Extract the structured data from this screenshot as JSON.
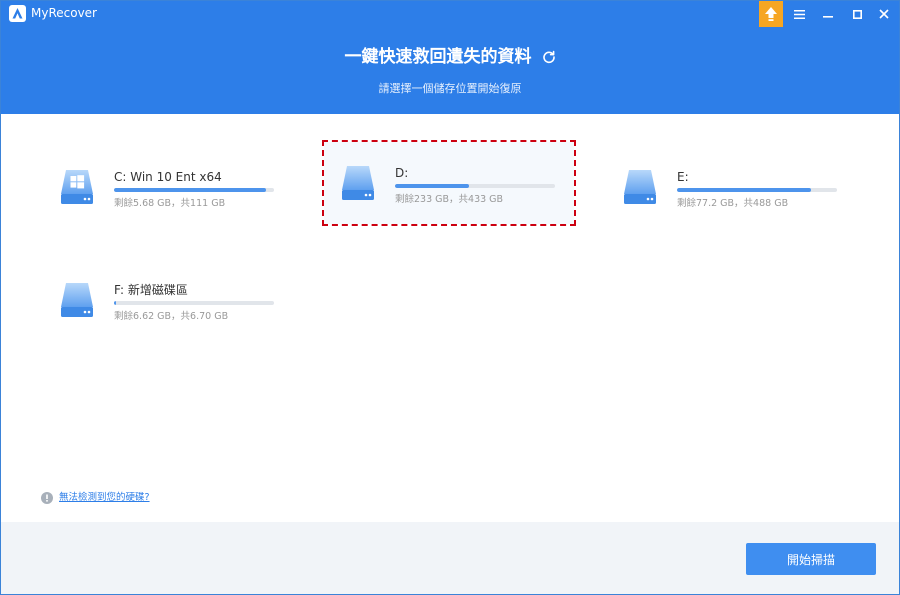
{
  "app": {
    "name": "MyRecover"
  },
  "header": {
    "title": "一鍵快速救回遺失的資料",
    "subtitle": "請選擇一個儲存位置開始復原"
  },
  "window_controls": [
    "upgrade-icon",
    "menu-icon",
    "minimize-icon",
    "maximize-icon",
    "close-icon"
  ],
  "drives": [
    {
      "id": "c",
      "name": "C: Win 10 Ent x64",
      "capacity": "剩餘5.68 GB，共111 GB",
      "used_fraction": 0.95,
      "icon": "windows-drive-icon",
      "selected": false
    },
    {
      "id": "d",
      "name": "D:",
      "capacity": "剩餘233 GB，共433 GB",
      "used_fraction": 0.46,
      "icon": "drive-icon",
      "selected": true
    },
    {
      "id": "e",
      "name": "E:",
      "capacity": "剩餘77.2 GB，共488 GB",
      "used_fraction": 0.84,
      "icon": "drive-icon",
      "selected": false
    },
    {
      "id": "f",
      "name": "F: 新增磁碟區",
      "capacity": "剩餘6.62 GB，共6.70 GB",
      "used_fraction": 0.01,
      "icon": "drive-icon",
      "selected": false
    }
  ],
  "help": {
    "link": "無法檢測到您的硬碟?"
  },
  "footer": {
    "start_button": "開始掃描"
  },
  "colors": {
    "header_bg": "#2d7ee8",
    "accent": "#3f8ef0",
    "progress_fill": "#4d94ec",
    "selection_border": "#cc0010",
    "upgrade_badge": "#f6a623",
    "footer_bg": "#f1f4f8"
  }
}
